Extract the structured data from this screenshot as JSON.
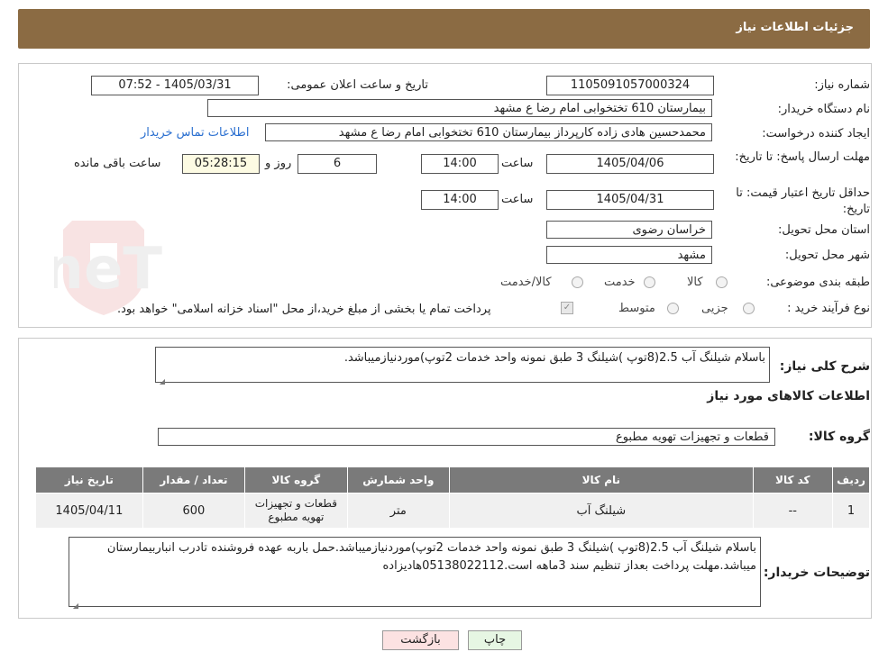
{
  "header": {
    "title": "جزئیات اطلاعات نیاز"
  },
  "watermark": {
    "text": "AriaTender.neT"
  },
  "form": {
    "need_number": {
      "label": "شماره نیاز:",
      "value": "1105091057000324"
    },
    "announce": {
      "label": "تاریخ و ساعت اعلان عمومی:",
      "value": "1405/03/31 - 07:52"
    },
    "buyer_org": {
      "label": "نام دستگاه خریدار:",
      "value": "بیمارستان 610 تختخوابی امام رضا ع  مشهد"
    },
    "creator": {
      "label": "ایجاد کننده درخواست:",
      "value": "محمدحسین هادی زاده کارپرداز بیمارستان 610 تختخوابی امام رضا ع  مشهد",
      "contact_link": "اطلاعات تماس خریدار"
    },
    "reply_deadline": {
      "label": "مهلت ارسال پاسخ: تا تاریخ:",
      "date": "1405/04/06",
      "time_label": "ساعت",
      "time": "14:00",
      "days": "6",
      "days_label": "روز و",
      "remaining": "05:28:15",
      "remaining_label": "ساعت باقی مانده"
    },
    "price_validity": {
      "label": "حداقل تاریخ اعتبار قیمت: تا تاریخ:",
      "date": "1405/04/31",
      "time_label": "ساعت",
      "time": "14:00"
    },
    "province": {
      "label": "استان محل تحویل:",
      "value": "خراسان رضوی"
    },
    "city": {
      "label": "شهر محل تحویل:",
      "value": "مشهد"
    },
    "category": {
      "label": "طبقه بندی موضوعی:",
      "options": [
        "کالا",
        "خدمت",
        "کالا/خدمت"
      ]
    },
    "process": {
      "label": "نوع فرآیند خرید :",
      "options": [
        "جزیی",
        "متوسط"
      ],
      "payment_note": "پرداخت تمام یا بخشی از مبلغ خرید،از محل \"اسناد خزانه اسلامی\" خواهد بود."
    }
  },
  "description": {
    "label": "شرح کلی نیاز:",
    "value": "باسلام شیلنگ آب 2.5(8توپ )شیلنگ 3 طبق نمونه واحد خدمات 2توپ)موردنیازمیباشد."
  },
  "goods_section": {
    "title": "اطلاعات کالاهای مورد نیاز"
  },
  "goods_group": {
    "label": "گروه کالا:",
    "value": "قطعات و تجهیزات تهویه مطبوع"
  },
  "table": {
    "headers": [
      "ردیف",
      "کد کالا",
      "نام کالا",
      "واحد شمارش",
      "گروه کالا",
      "تعداد / مقدار",
      "تاریخ نیاز"
    ],
    "rows": [
      [
        "1",
        "--",
        "شیلنگ آب",
        "متر",
        "قطعات و تجهیزات تهویه مطبوع",
        "600",
        "1405/04/11"
      ]
    ]
  },
  "buyer_notes": {
    "label": "توضیحات خریدار:",
    "value": "باسلام شیلنگ آب 2.5(8توپ )شیلنگ 3 طبق نمونه واحد خدمات 2توپ)موردنیازمیباشد.حمل باربه عهده فروشنده تادرب انباربیمارستان میباشد.مهلت پرداخت بعداز تنظیم سند 3ماهه است.05138022112هادیزاده"
  },
  "buttons": {
    "print": "چاپ",
    "back": "بازگشت"
  },
  "colors": {
    "header_bg": "#8b6b43",
    "table_header_bg": "#7a7a7a",
    "link": "#2a6fd0"
  }
}
